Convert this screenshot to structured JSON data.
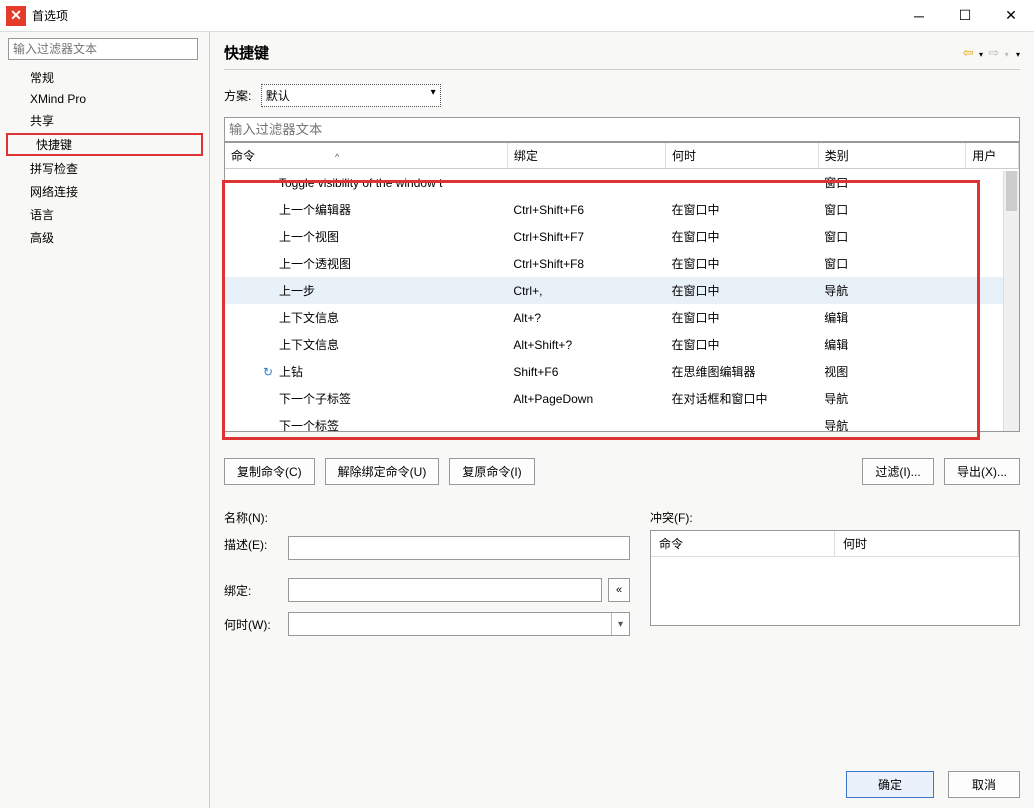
{
  "window": {
    "title": "首选项"
  },
  "sidebar": {
    "filter_placeholder": "输入过滤器文本",
    "items": [
      {
        "label": "常规"
      },
      {
        "label": "XMind Pro"
      },
      {
        "label": "共享"
      },
      {
        "label": "快捷键",
        "selected": true
      },
      {
        "label": "拼写检查"
      },
      {
        "label": "网络连接"
      },
      {
        "label": "语言"
      },
      {
        "label": "高级"
      }
    ]
  },
  "main": {
    "title": "快捷键",
    "scheme_label": "方案:",
    "scheme_value": "默认",
    "filter_placeholder": "输入过滤器文本",
    "columns": {
      "command": "命令",
      "binding": "绑定",
      "when": "何时",
      "category": "类别",
      "user": "用户"
    },
    "rows": [
      {
        "cmd": "Toggle visibility of the window t",
        "bind": "",
        "when": "",
        "cat": "窗口"
      },
      {
        "cmd": "上一个编辑器",
        "bind": "Ctrl+Shift+F6",
        "when": "在窗口中",
        "cat": "窗口"
      },
      {
        "cmd": "上一个视图",
        "bind": "Ctrl+Shift+F7",
        "when": "在窗口中",
        "cat": "窗口"
      },
      {
        "cmd": "上一个透视图",
        "bind": "Ctrl+Shift+F8",
        "when": "在窗口中",
        "cat": "窗口"
      },
      {
        "cmd": "上一步",
        "bind": "Ctrl+,",
        "when": "在窗口中",
        "cat": "导航",
        "selected": true
      },
      {
        "cmd": "上下文信息",
        "bind": "Alt+?",
        "when": "在窗口中",
        "cat": "编辑"
      },
      {
        "cmd": "上下文信息",
        "bind": "Alt+Shift+?",
        "when": "在窗口中",
        "cat": "编辑"
      },
      {
        "cmd": "上钻",
        "bind": "Shift+F6",
        "when": "在思维图编辑器",
        "cat": "视图",
        "icon": true
      },
      {
        "cmd": "下一个子标签",
        "bind": "Alt+PageDown",
        "when": "在对话框和窗口中",
        "cat": "导航"
      },
      {
        "cmd": "下一个标签",
        "bind": "",
        "when": "",
        "cat": "导航"
      }
    ],
    "buttons": {
      "copy": "复制命令(C)",
      "unbind": "解除绑定命令(U)",
      "restore": "复原命令(I)",
      "filter": "过滤(I)...",
      "export": "导出(X)..."
    },
    "form": {
      "name_label": "名称(N):",
      "desc_label": "描述(E):",
      "binding_label": "绑定:",
      "when_label": "何时(W):",
      "conflict_label": "冲突(F):",
      "conflict_cols": {
        "command": "命令",
        "when": "何时"
      }
    }
  },
  "footer": {
    "ok": "确定",
    "cancel": "取消"
  }
}
